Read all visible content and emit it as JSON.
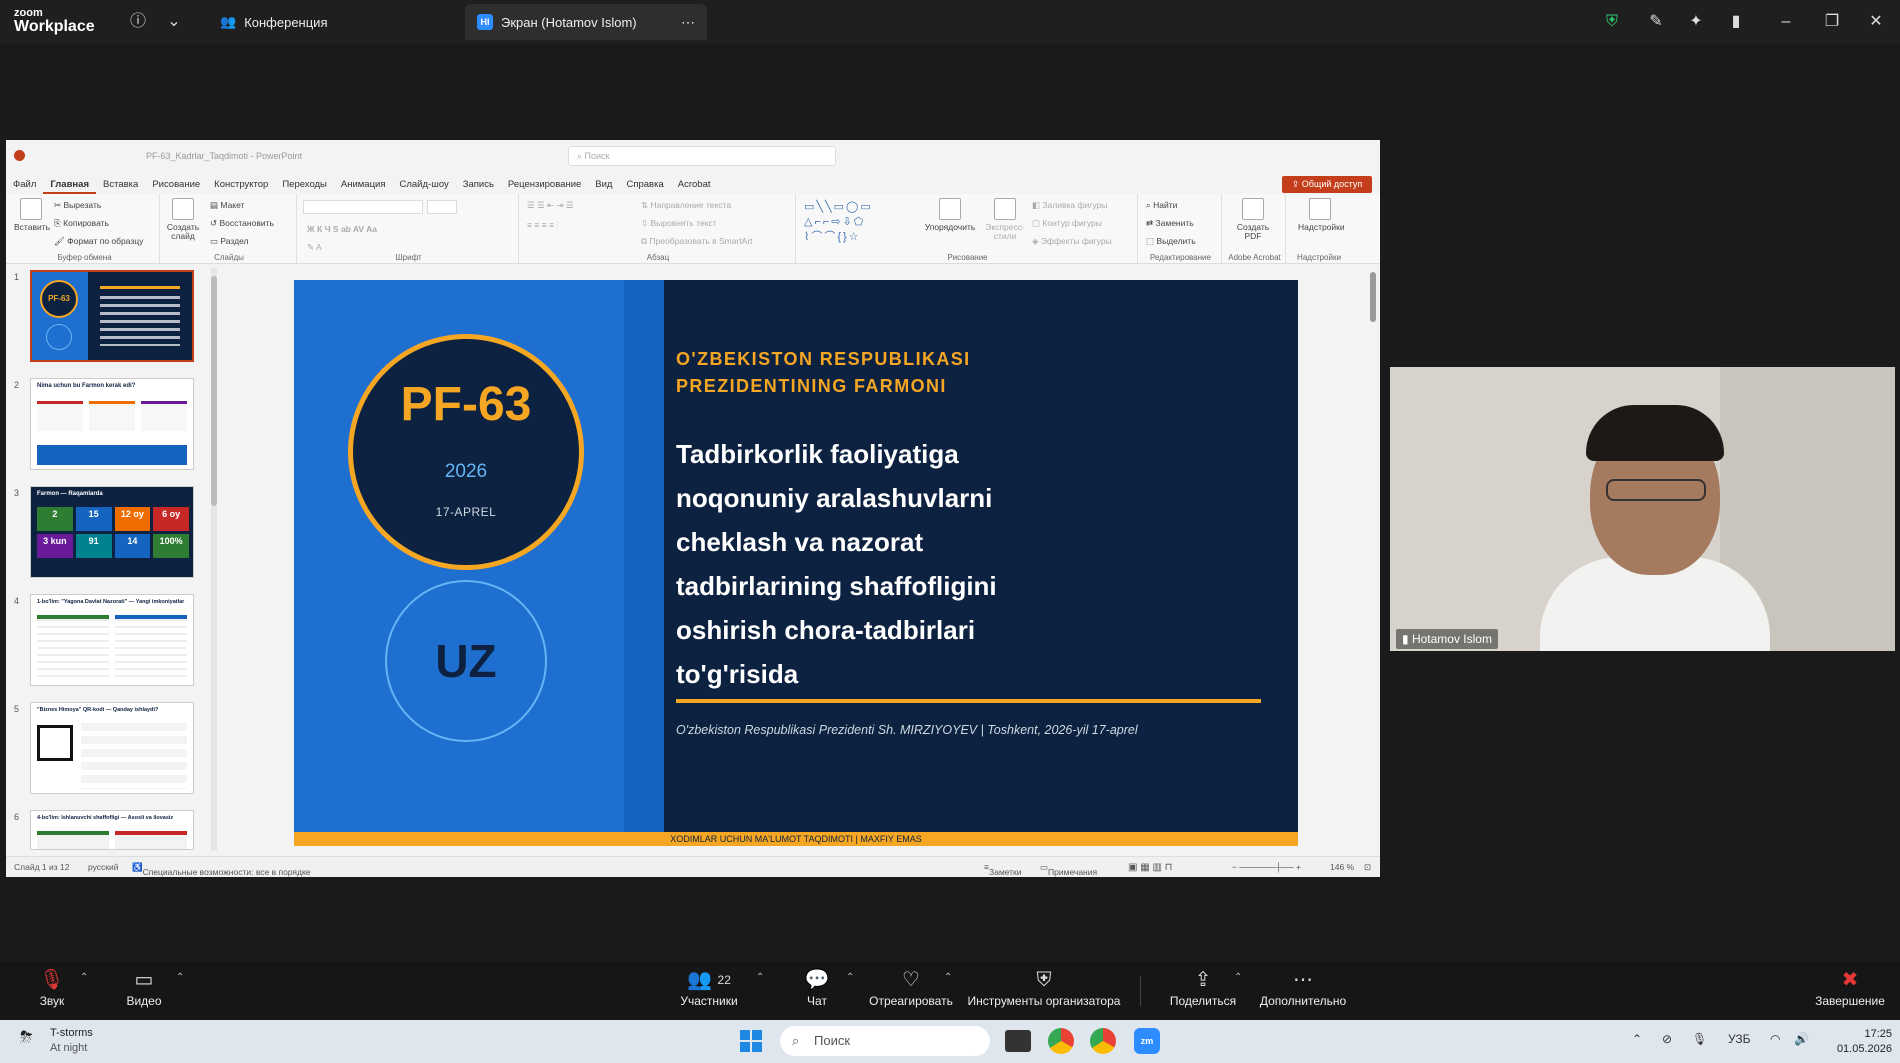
{
  "zoom": {
    "logo_line1": "zoom",
    "logo_line2": "Workplace",
    "tab_conference": "Конференция",
    "tab_screen": "Экран (Hotamov Islom)",
    "tab_screen_badge": "HI"
  },
  "ppt": {
    "title": "PF-63_Kadrlar_Taqdimoti - PowerPoint",
    "search_placeholder": "Поиск",
    "menu": [
      "Файл",
      "Главная",
      "Вставка",
      "Рисование",
      "Конструктор",
      "Переходы",
      "Анимация",
      "Слайд-шоу",
      "Запись",
      "Рецензирование",
      "Вид",
      "Справка",
      "Acrobat"
    ],
    "active_menu_index": 1,
    "share_label": "Общий доступ",
    "ribbon": {
      "clipboard": {
        "paste": "Вставить",
        "cut": "Вырезать",
        "copy": "Копировать",
        "format": "Формат по образцу",
        "label": "Буфер обмена"
      },
      "slides": {
        "new_slide": "Создать слайд",
        "layout": "Макет",
        "reset": "Восстановить",
        "section": "Раздел",
        "label": "Слайды"
      },
      "font": {
        "label": "Шрифт"
      },
      "paragraph": {
        "text_direction": "Направление текста",
        "align_text": "Выровнять текст",
        "smartart": "Преобразовать в SmartArt",
        "label": "Абзац"
      },
      "drawing": {
        "arrange": "Упорядочить",
        "quick_styles": "Экспресс-стили",
        "fill": "Заливка фигуры",
        "outline": "Контур фигуры",
        "effects": "Эффекты фигуры",
        "label": "Рисование"
      },
      "editing": {
        "find": "Найти",
        "replace": "Заменить",
        "select": "Выделить",
        "label": "Редактирование"
      },
      "acrobat": {
        "create_pdf": "Создать PDF",
        "label": "Adobe Acrobat"
      },
      "addins": {
        "addins": "Надстройки",
        "label": "Надстройки"
      }
    },
    "thumbnails": [
      {
        "num": "1",
        "title": "PF-63"
      },
      {
        "num": "2",
        "title": "Nima uchun bu Farmon kerak edi?"
      },
      {
        "num": "3",
        "title": "Farmon — Raqamlarda"
      },
      {
        "num": "4",
        "title": "1-bo'lim: \"Yagona Davlat Nazorati\" — Yangi imkoniyatlar"
      },
      {
        "num": "5",
        "title": "\"Biznes Himoya\" QR-kodi — Qanday ishlaydi?"
      },
      {
        "num": "6",
        "title": "4-bo'lim: Ishlanuvchi shaffofligi — Asosli va ilovasiz"
      }
    ],
    "thumb3_cells": [
      "2",
      "15",
      "12 oy",
      "6 oy",
      "3 kun",
      "91",
      "14",
      "100%"
    ],
    "status": {
      "slide_of": "Слайд 1 из 12",
      "language": "русский",
      "accessibility": "Специальные возможности: все в порядке",
      "notes": "Заметки",
      "comments": "Примечания",
      "zoom": "146 %"
    }
  },
  "slide": {
    "code": "PF-63",
    "year": "2026",
    "date": "17-APREL",
    "country": "UZ",
    "header_line1": "O'ZBEKISTON RESPUBLIKASI",
    "header_line2": "PREZIDENTINING FARMONI",
    "body_lines": [
      "Tadbirkorlik faoliyatiga",
      "noqonuniy aralashuvlarni",
      "cheklash va nazorat",
      "tadbirlarining shaffofligini",
      "oshirish chora-tadbirlari",
      "to'g'risida"
    ],
    "signature": "O'zbekiston Respublikasi Prezidenti Sh. MIRZIYOYEV  |  Toshkent, 2026-yil 17-aprel",
    "footer": "XODIMLAR UCHUN MA'LUMOT TAQDIMOTI  |  MAXFIY EMAS"
  },
  "participant": {
    "name": "Hotamov Islom"
  },
  "controls": {
    "audio": "Звук",
    "video": "Видео",
    "participants": "Участники",
    "participants_count": "22",
    "chat": "Чат",
    "react": "Отреагировать",
    "host_tools": "Инструменты организатора",
    "share": "Поделиться",
    "more": "Дополнительно",
    "end": "Завершение"
  },
  "taskbar": {
    "weather_title": "T-storms",
    "weather_sub": "At night",
    "search": "Поиск",
    "lang": "УЗБ",
    "time": "17:25",
    "date": "01.05.2026"
  }
}
